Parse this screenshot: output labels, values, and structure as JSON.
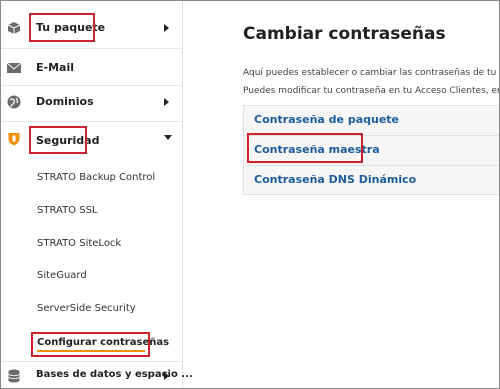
{
  "sidebar": {
    "items": [
      {
        "label": "Tu paquete",
        "icon": "package-icon",
        "chevron": "right"
      },
      {
        "label": "E-Mail",
        "icon": "email-icon",
        "chevron": ""
      },
      {
        "label": "Dominios",
        "icon": "globe-icon",
        "chevron": "right"
      },
      {
        "label": "Seguridad",
        "icon": "shield-icon",
        "chevron": "down"
      },
      {
        "label": "Bases de datos y espacio ...",
        "icon": "database-icon",
        "chevron": "right"
      }
    ],
    "security_subitems": [
      "STRATO Backup Control",
      "STRATO SSL",
      "STRATO SiteLock",
      "SiteGuard",
      "ServerSide Security",
      "Configurar contraseñas"
    ]
  },
  "main": {
    "title": "Cambiar contraseñas",
    "desc1": "Aquí puedes establecer o cambiar las contraseñas de tu paque",
    "desc2": "Puedes modificar tu contraseña en tu Acceso Clientes, en el m",
    "options": [
      "Contraseña de paquete",
      "Contraseña maestra",
      "Contraseña DNS Dinámico"
    ]
  },
  "colors": {
    "highlight_box": "#d0202a",
    "active_underline": "#f39200",
    "link": "#1d5c9c",
    "shield": "#f39200"
  }
}
